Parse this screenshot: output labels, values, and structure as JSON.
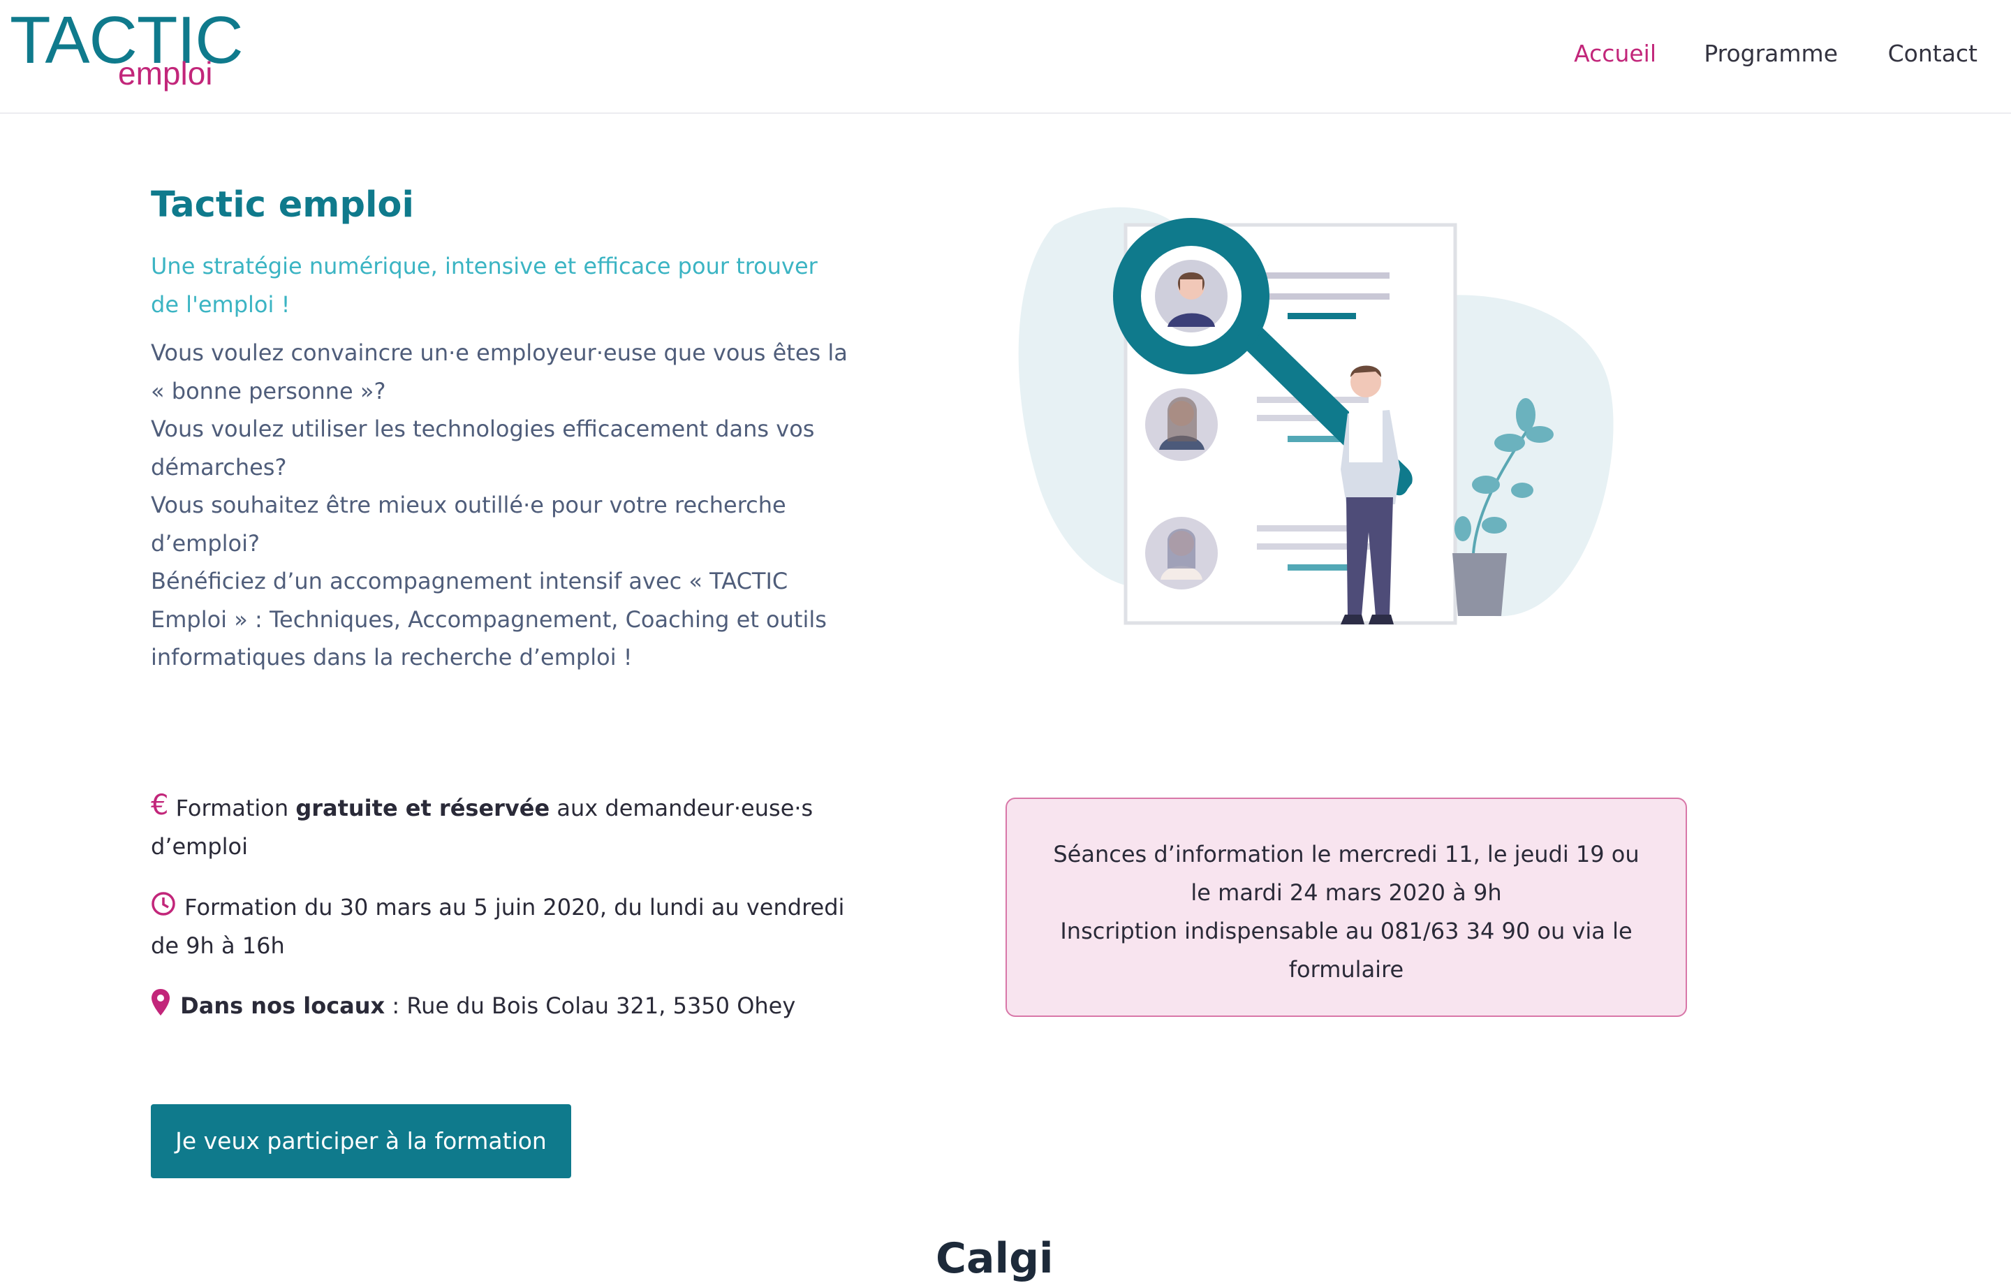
{
  "header": {
    "logo_main": "TACTIC",
    "logo_sub": "emploi",
    "nav": [
      {
        "label": "Accueil",
        "active": true
      },
      {
        "label": "Programme",
        "active": false
      },
      {
        "label": "Contact",
        "active": false
      }
    ]
  },
  "intro": {
    "title": "Tactic emploi",
    "lead": "Une stratégie numérique, intensive et efficace pour trouver de l'emploi !",
    "paragraphs": [
      "Vous voulez convaincre un·e employeur·euse que vous êtes la « bonne personne »?",
      "Vous voulez utiliser les technologies efficacement dans vos démarches?",
      "Vous souhaitez être mieux outillé·e pour votre recherche d’emploi?",
      "Bénéficiez d’un accompagnement intensif avec « TACTIC Emploi » : Techniques, Accompagnement, Coaching et outils informatiques dans la recherche d’emploi !"
    ]
  },
  "info": {
    "price": {
      "icon": "euro-icon",
      "pre": "Formation ",
      "bold": "gratuite et réservée",
      "post": " aux demandeur·euse·s d’emploi"
    },
    "dates": {
      "icon": "clock-icon",
      "text": "Formation du 30 mars au 5 juin 2020, du lundi au vendredi de 9h à 16h"
    },
    "location": {
      "icon": "map-pin-icon",
      "bold": "Dans nos locaux",
      "post": " : Rue du Bois Colau 321, 5350 Ohey"
    }
  },
  "notice": {
    "lines": [
      "Séances d’information le mercredi 11, le jeudi 19 ou",
      "le mardi 24 mars 2020 à 9h",
      "Inscription indispensable au 081/63 34 90 ou via le",
      "formulaire"
    ]
  },
  "cta": {
    "label": "Je veux participer à la formation"
  },
  "next_section_peek": "Calgi",
  "colors": {
    "teal": "#0f7a8c",
    "light_teal": "#3bb4c3",
    "magenta": "#c2267a",
    "notice_bg": "#f8e4ef",
    "body_text": "#4f5d7a"
  }
}
